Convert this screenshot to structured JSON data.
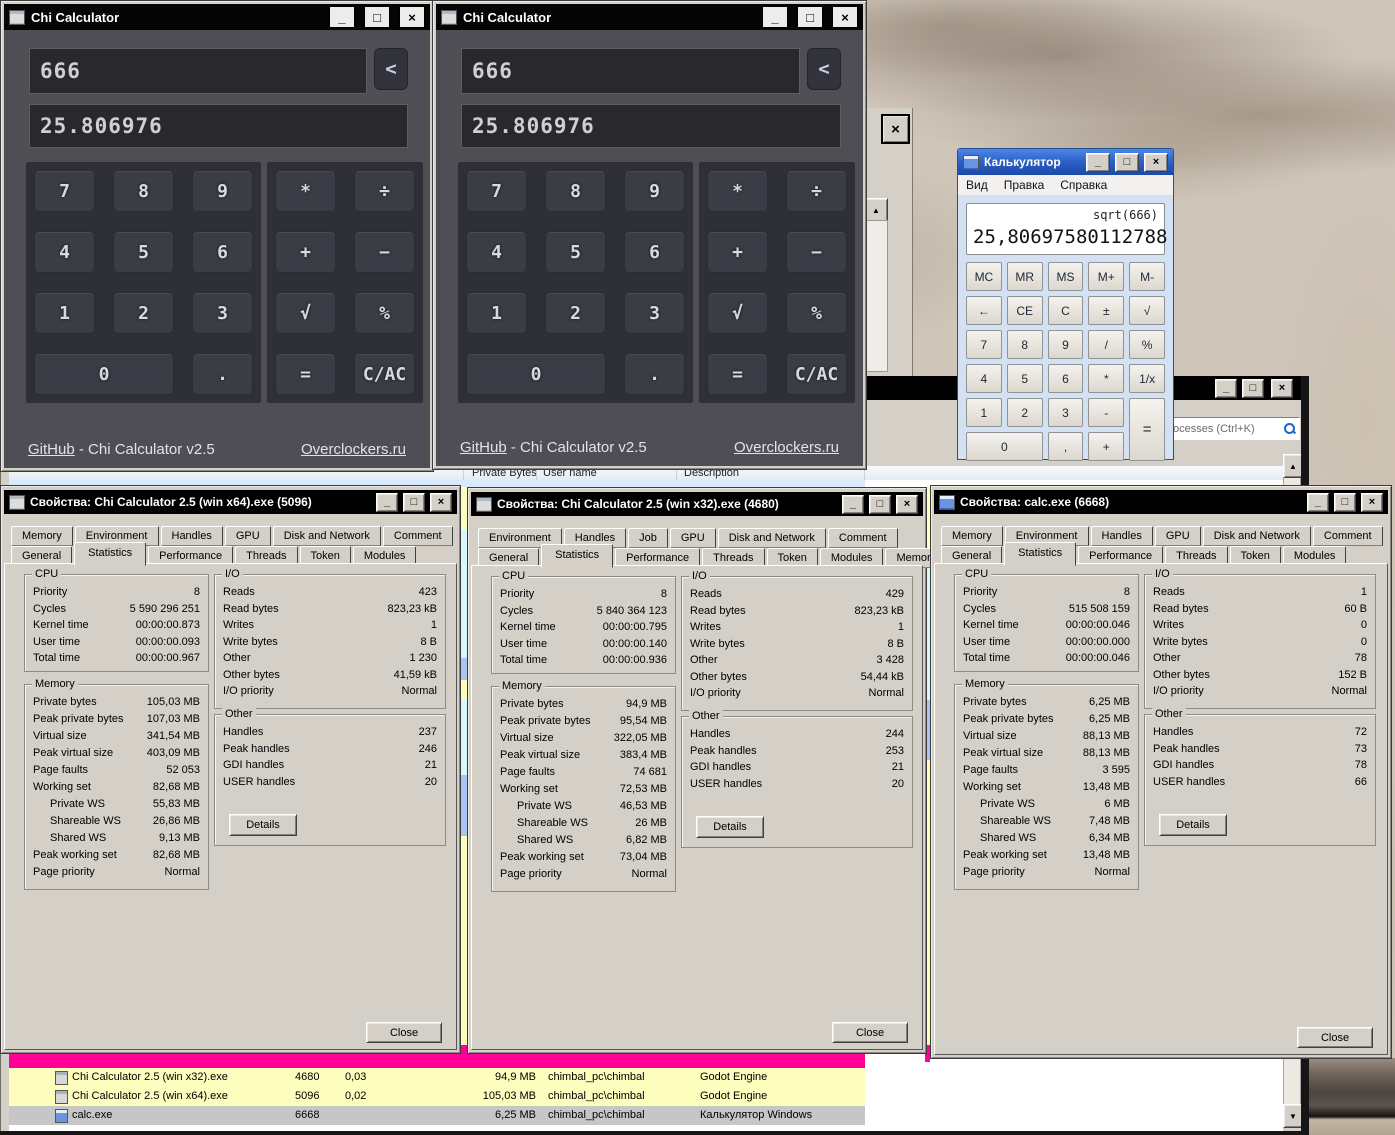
{
  "chrome": {
    "minimize": "_",
    "maximize": "□",
    "close": "×",
    "scroll_up": "▲",
    "scroll_down": "▼"
  },
  "chi_calculator": {
    "title": "Chi Calculator",
    "input": "666",
    "result": "25.806976",
    "backspace_label": "<",
    "keys_left": [
      "7",
      "8",
      "9",
      "4",
      "5",
      "6",
      "1",
      "2",
      "3",
      "0",
      "."
    ],
    "keys_right": [
      "*",
      "÷",
      "+",
      "−",
      "√",
      "%",
      "=",
      "C/AC"
    ],
    "footer": {
      "link_left": "GitHub",
      "text": " - Chi Calculator v2.5",
      "link_right": "Overclockers.ru"
    }
  },
  "win_calc": {
    "title": "Калькулятор",
    "menu": [
      "Вид",
      "Правка",
      "Справка"
    ],
    "expression": "sqrt(666)",
    "display": "25,80697580112788",
    "key_rows": [
      [
        "MC",
        "MR",
        "MS",
        "M+",
        "M-"
      ],
      [
        "←",
        "CE",
        "C",
        "±",
        "√"
      ],
      [
        "7",
        "8",
        "9",
        "/",
        "%"
      ],
      [
        "4",
        "5",
        "6",
        "*",
        "1/x"
      ],
      [
        "1",
        "2",
        "3",
        "-",
        "="
      ],
      [
        "0",
        ",",
        "+"
      ]
    ]
  },
  "process_hacker": {
    "search_text": "ocesses (Ctrl+K)",
    "columns": [
      "Private Bytes",
      "User name",
      "Description"
    ],
    "rows": [
      {
        "name": "Chi Calculator 2.5 (win x32).exe",
        "pid": "4680",
        "cpu": "0,03",
        "memory": "94,9 MB",
        "user": "chimbal_pc\\chimbal",
        "description": "Godot Engine",
        "color": "#fdfdbe",
        "icon": "chi-calculator-icon"
      },
      {
        "name": "Chi Calculator 2.5 (win x64).exe",
        "pid": "5096",
        "cpu": "0,02",
        "memory": "105,03 MB",
        "user": "chimbal_pc\\chimbal",
        "description": "Godot Engine",
        "color": "#fdfdbe",
        "icon": "chi-calculator-icon"
      },
      {
        "name": "calc.exe",
        "pid": "6668",
        "cpu": "",
        "memory": "6,25 MB",
        "user": "chimbal_pc\\chimbal",
        "description": "Калькулятор Windows",
        "color": "#c6c6c6",
        "icon": "windows-calculator-icon"
      }
    ]
  },
  "props": [
    {
      "title": "Свойства: Chi Calculator 2.5 (win x64).exe (5096)",
      "tabs_top": [
        "Memory",
        "Environment",
        "Handles",
        "GPU",
        "Disk and Network",
        "Comment"
      ],
      "tabs_bottom": [
        "General",
        "Statistics",
        "Performance",
        "Threads",
        "Token",
        "Modules"
      ],
      "selected_tab": "Statistics",
      "groups": {
        "cpu": {
          "title": "CPU",
          "rows": [
            {
              "label": "Priority",
              "value": "8"
            },
            {
              "label": "Cycles",
              "value": "5 590 296 251"
            },
            {
              "label": "Kernel time",
              "value": "00:00:00.873"
            },
            {
              "label": "User time",
              "value": "00:00:00.093"
            },
            {
              "label": "Total time",
              "value": "00:00:00.967"
            }
          ]
        },
        "io": {
          "title": "I/O",
          "rows": [
            {
              "label": "Reads",
              "value": "423"
            },
            {
              "label": "Read bytes",
              "value": "823,23 kB"
            },
            {
              "label": "Writes",
              "value": "1"
            },
            {
              "label": "Write bytes",
              "value": "8 B"
            },
            {
              "label": "Other",
              "value": "1 230"
            },
            {
              "label": "Other bytes",
              "value": "41,59 kB"
            },
            {
              "label": "I/O priority",
              "value": "Normal"
            }
          ]
        },
        "memory": {
          "title": "Memory",
          "rows": [
            {
              "label": "Private bytes",
              "value": "105,03 MB"
            },
            {
              "label": "Peak private bytes",
              "value": "107,03 MB"
            },
            {
              "label": "Virtual size",
              "value": "341,54 MB"
            },
            {
              "label": "Peak virtual size",
              "value": "403,09 MB"
            },
            {
              "label": "Page faults",
              "value": "52 053"
            },
            {
              "label": "Working set",
              "value": "82,68 MB"
            },
            {
              "label": "Private WS",
              "value": "55,83 MB",
              "indent": true
            },
            {
              "label": "Shareable WS",
              "value": "26,86 MB",
              "indent": true
            },
            {
              "label": "Shared WS",
              "value": "9,13 MB",
              "indent": true
            },
            {
              "label": "Peak working set",
              "value": "82,68 MB"
            },
            {
              "label": "Page priority",
              "value": "Normal"
            }
          ]
        },
        "other": {
          "title": "Other",
          "rows": [
            {
              "label": "Handles",
              "value": "237"
            },
            {
              "label": "Peak handles",
              "value": "246"
            },
            {
              "label": "GDI handles",
              "value": "21"
            },
            {
              "label": "USER handles",
              "value": "20"
            }
          ]
        }
      },
      "details_label": "Details",
      "close_label": "Close"
    },
    {
      "title": "Свойства: Chi Calculator 2.5 (win x32).exe (4680)",
      "tabs_top": [
        "Environment",
        "Handles",
        "Job",
        "GPU",
        "Disk and Network",
        "Comment"
      ],
      "tabs_bottom": [
        "General",
        "Statistics",
        "Performance",
        "Threads",
        "Token",
        "Modules",
        "Memory"
      ],
      "selected_tab": "Statistics",
      "groups": {
        "cpu": {
          "title": "CPU",
          "rows": [
            {
              "label": "Priority",
              "value": "8"
            },
            {
              "label": "Cycles",
              "value": "5 840 364 123"
            },
            {
              "label": "Kernel time",
              "value": "00:00:00.795"
            },
            {
              "label": "User time",
              "value": "00:00:00.140"
            },
            {
              "label": "Total time",
              "value": "00:00:00.936"
            }
          ]
        },
        "io": {
          "title": "I/O",
          "rows": [
            {
              "label": "Reads",
              "value": "429"
            },
            {
              "label": "Read bytes",
              "value": "823,23 kB"
            },
            {
              "label": "Writes",
              "value": "1"
            },
            {
              "label": "Write bytes",
              "value": "8 B"
            },
            {
              "label": "Other",
              "value": "3 428"
            },
            {
              "label": "Other bytes",
              "value": "54,44 kB"
            },
            {
              "label": "I/O priority",
              "value": "Normal"
            }
          ]
        },
        "memory": {
          "title": "Memory",
          "rows": [
            {
              "label": "Private bytes",
              "value": "94,9 MB"
            },
            {
              "label": "Peak private bytes",
              "value": "95,54 MB"
            },
            {
              "label": "Virtual size",
              "value": "322,05 MB"
            },
            {
              "label": "Peak virtual size",
              "value": "383,4 MB"
            },
            {
              "label": "Page faults",
              "value": "74 681"
            },
            {
              "label": "Working set",
              "value": "72,53 MB"
            },
            {
              "label": "Private WS",
              "value": "46,53 MB",
              "indent": true
            },
            {
              "label": "Shareable WS",
              "value": "26 MB",
              "indent": true
            },
            {
              "label": "Shared WS",
              "value": "6,82 MB",
              "indent": true
            },
            {
              "label": "Peak working set",
              "value": "73,04 MB"
            },
            {
              "label": "Page priority",
              "value": "Normal"
            }
          ]
        },
        "other": {
          "title": "Other",
          "rows": [
            {
              "label": "Handles",
              "value": "244"
            },
            {
              "label": "Peak handles",
              "value": "253"
            },
            {
              "label": "GDI handles",
              "value": "21"
            },
            {
              "label": "USER handles",
              "value": "20"
            }
          ]
        }
      },
      "details_label": "Details",
      "close_label": "Close"
    },
    {
      "title": "Свойства: calc.exe (6668)",
      "tabs_top": [
        "Memory",
        "Environment",
        "Handles",
        "GPU",
        "Disk and Network",
        "Comment"
      ],
      "tabs_bottom": [
        "General",
        "Statistics",
        "Performance",
        "Threads",
        "Token",
        "Modules"
      ],
      "selected_tab": "Statistics",
      "groups": {
        "cpu": {
          "title": "CPU",
          "rows": [
            {
              "label": "Priority",
              "value": "8"
            },
            {
              "label": "Cycles",
              "value": "515 508 159"
            },
            {
              "label": "Kernel time",
              "value": "00:00:00.046"
            },
            {
              "label": "User time",
              "value": "00:00:00.000"
            },
            {
              "label": "Total time",
              "value": "00:00:00.046"
            }
          ]
        },
        "io": {
          "title": "I/O",
          "rows": [
            {
              "label": "Reads",
              "value": "1"
            },
            {
              "label": "Read bytes",
              "value": "60 B"
            },
            {
              "label": "Writes",
              "value": "0"
            },
            {
              "label": "Write bytes",
              "value": "0"
            },
            {
              "label": "Other",
              "value": "78"
            },
            {
              "label": "Other bytes",
              "value": "152 B"
            },
            {
              "label": "I/O priority",
              "value": "Normal"
            }
          ]
        },
        "memory": {
          "title": "Memory",
          "rows": [
            {
              "label": "Private bytes",
              "value": "6,25 MB"
            },
            {
              "label": "Peak private bytes",
              "value": "6,25 MB"
            },
            {
              "label": "Virtual size",
              "value": "88,13 MB"
            },
            {
              "label": "Peak virtual size",
              "value": "88,13 MB"
            },
            {
              "label": "Page faults",
              "value": "3 595"
            },
            {
              "label": "Working set",
              "value": "13,48 MB"
            },
            {
              "label": "Private WS",
              "value": "6 MB",
              "indent": true
            },
            {
              "label": "Shareable WS",
              "value": "7,48 MB",
              "indent": true
            },
            {
              "label": "Shared WS",
              "value": "6,34 MB",
              "indent": true
            },
            {
              "label": "Peak working set",
              "value": "13,48 MB"
            },
            {
              "label": "Page priority",
              "value": "Normal"
            }
          ]
        },
        "other": {
          "title": "Other",
          "rows": [
            {
              "label": "Handles",
              "value": "72"
            },
            {
              "label": "Peak handles",
              "value": "73"
            },
            {
              "label": "GDI handles",
              "value": "78"
            },
            {
              "label": "USER handles",
              "value": "66"
            }
          ]
        }
      },
      "details_label": "Details",
      "close_label": "Close"
    }
  ]
}
